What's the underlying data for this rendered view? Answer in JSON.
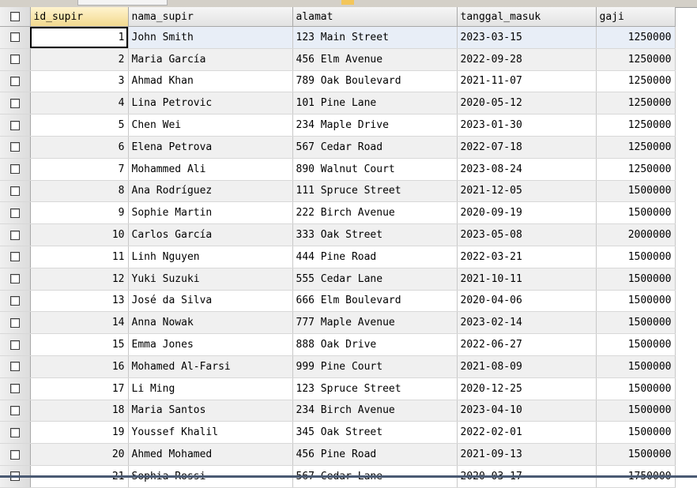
{
  "columns": {
    "id_supir": "id_supir",
    "nama_supir": "nama_supir",
    "alamat": "alamat",
    "tanggal_masuk": "tanggal_masuk",
    "gaji": "gaji"
  },
  "rows": [
    {
      "id_supir": "1",
      "nama_supir": "John Smith",
      "alamat": "123 Main Street",
      "tanggal_masuk": "2023-03-15",
      "gaji": "1250000"
    },
    {
      "id_supir": "2",
      "nama_supir": "Maria García",
      "alamat": "456 Elm Avenue",
      "tanggal_masuk": "2022-09-28",
      "gaji": "1250000"
    },
    {
      "id_supir": "3",
      "nama_supir": "Ahmad Khan",
      "alamat": "789 Oak Boulevard",
      "tanggal_masuk": "2021-11-07",
      "gaji": "1250000"
    },
    {
      "id_supir": "4",
      "nama_supir": "Lina Petrovic",
      "alamat": "101 Pine Lane",
      "tanggal_masuk": "2020-05-12",
      "gaji": "1250000"
    },
    {
      "id_supir": "5",
      "nama_supir": "Chen Wei",
      "alamat": "234 Maple Drive",
      "tanggal_masuk": "2023-01-30",
      "gaji": "1250000"
    },
    {
      "id_supir": "6",
      "nama_supir": "Elena Petrova",
      "alamat": "567 Cedar Road",
      "tanggal_masuk": "2022-07-18",
      "gaji": "1250000"
    },
    {
      "id_supir": "7",
      "nama_supir": "Mohammed Ali",
      "alamat": "890 Walnut Court",
      "tanggal_masuk": "2023-08-24",
      "gaji": "1250000"
    },
    {
      "id_supir": "8",
      "nama_supir": "Ana Rodríguez",
      "alamat": "111 Spruce Street",
      "tanggal_masuk": "2021-12-05",
      "gaji": "1500000"
    },
    {
      "id_supir": "9",
      "nama_supir": "Sophie Martin",
      "alamat": "222 Birch Avenue",
      "tanggal_masuk": "2020-09-19",
      "gaji": "1500000"
    },
    {
      "id_supir": "10",
      "nama_supir": "Carlos García",
      "alamat": "333 Oak Street",
      "tanggal_masuk": "2023-05-08",
      "gaji": "2000000"
    },
    {
      "id_supir": "11",
      "nama_supir": "Linh Nguyen",
      "alamat": "444 Pine Road",
      "tanggal_masuk": "2022-03-21",
      "gaji": "1500000"
    },
    {
      "id_supir": "12",
      "nama_supir": "Yuki Suzuki",
      "alamat": "555 Cedar Lane",
      "tanggal_masuk": "2021-10-11",
      "gaji": "1500000"
    },
    {
      "id_supir": "13",
      "nama_supir": "José da Silva",
      "alamat": "666 Elm Boulevard",
      "tanggal_masuk": "2020-04-06",
      "gaji": "1500000"
    },
    {
      "id_supir": "14",
      "nama_supir": "Anna Nowak",
      "alamat": "777 Maple Avenue",
      "tanggal_masuk": "2023-02-14",
      "gaji": "1500000"
    },
    {
      "id_supir": "15",
      "nama_supir": "Emma Jones",
      "alamat": "888 Oak Drive",
      "tanggal_masuk": "2022-06-27",
      "gaji": "1500000"
    },
    {
      "id_supir": "16",
      "nama_supir": "Mohamed Al-Farsi",
      "alamat": "999 Pine Court",
      "tanggal_masuk": "2021-08-09",
      "gaji": "1500000"
    },
    {
      "id_supir": "17",
      "nama_supir": "Li Ming",
      "alamat": "123 Spruce Street",
      "tanggal_masuk": "2020-12-25",
      "gaji": "1500000"
    },
    {
      "id_supir": "18",
      "nama_supir": "Maria Santos",
      "alamat": "234 Birch Avenue",
      "tanggal_masuk": "2023-04-10",
      "gaji": "1500000"
    },
    {
      "id_supir": "19",
      "nama_supir": "Youssef Khalil",
      "alamat": "345 Oak Street",
      "tanggal_masuk": "2022-02-01",
      "gaji": "1500000"
    },
    {
      "id_supir": "20",
      "nama_supir": "Ahmed Mohamed",
      "alamat": "456 Pine Road",
      "tanggal_masuk": "2021-09-13",
      "gaji": "1500000"
    },
    {
      "id_supir": "21",
      "nama_supir": "Sophia Rossi",
      "alamat": "567 Cedar Lane",
      "tanggal_masuk": "2020-03-17",
      "gaji": "1750000"
    }
  ],
  "colors": {
    "header_sorted": "#f2d98e",
    "row_alt": "#f0f0f0",
    "row_selected": "#e8eef7"
  }
}
